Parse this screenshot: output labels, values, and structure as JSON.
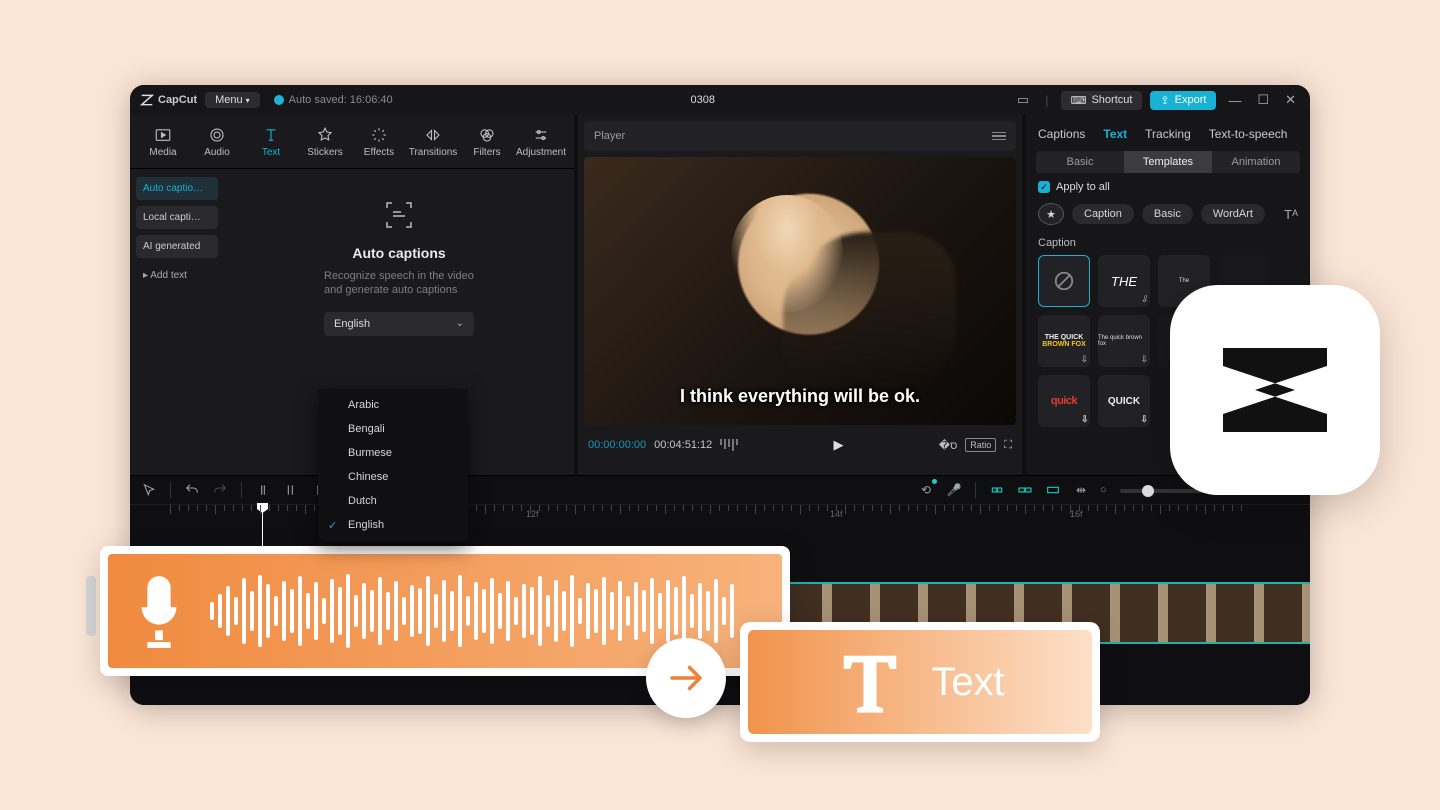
{
  "topbar": {
    "app_name": "CapCut",
    "menu_label": "Menu",
    "autosave_text": "Auto saved: 16:06:40",
    "project_title": "0308",
    "shortcut_label": "Shortcut",
    "export_label": "Export"
  },
  "modebar": {
    "items": [
      "Media",
      "Audio",
      "Text",
      "Stickers",
      "Effects",
      "Transitions",
      "Filters",
      "Adjustment"
    ],
    "active": "Text"
  },
  "side": {
    "items": [
      "Auto captio…",
      "Local capti…",
      "AI generated",
      "▸ Add text"
    ],
    "active_index": 0
  },
  "autocaptions": {
    "title": "Auto captions",
    "description": "Recognize speech in the video and generate auto captions",
    "selected_language": "English",
    "options": [
      "Arabic",
      "Bengali",
      "Burmese",
      "Chinese",
      "Dutch",
      "English"
    ],
    "checked_index": 5
  },
  "player": {
    "label": "Player",
    "caption": "I think everything will be ok.",
    "time_current": "00:00:00:00",
    "time_duration": "00:04:51:12",
    "ratio_label": "Ratio"
  },
  "right": {
    "tabs": [
      "Captions",
      "Text",
      "Tracking",
      "Text-to-speech"
    ],
    "active_tab": "Text",
    "subtabs": [
      "Basic",
      "Templates",
      "Animation"
    ],
    "active_subtab": "Templates",
    "apply_all": "Apply to all",
    "chips": [
      "Caption",
      "Basic",
      "WordArt"
    ],
    "caption_label": "Caption",
    "thumb_the": "THE",
    "thumb_tiny1": "The",
    "thumb_fox1": "THE QUICK",
    "thumb_fox2": "BROWN FOX",
    "thumb_tiny2": "The quick brown fox",
    "thumb_quick1": "quick",
    "thumb_quick2": "QUICK"
  },
  "ruler": {
    "f12": "12f",
    "f14": "14f",
    "f16": "16f"
  },
  "overlay": {
    "text_label": "Text"
  }
}
